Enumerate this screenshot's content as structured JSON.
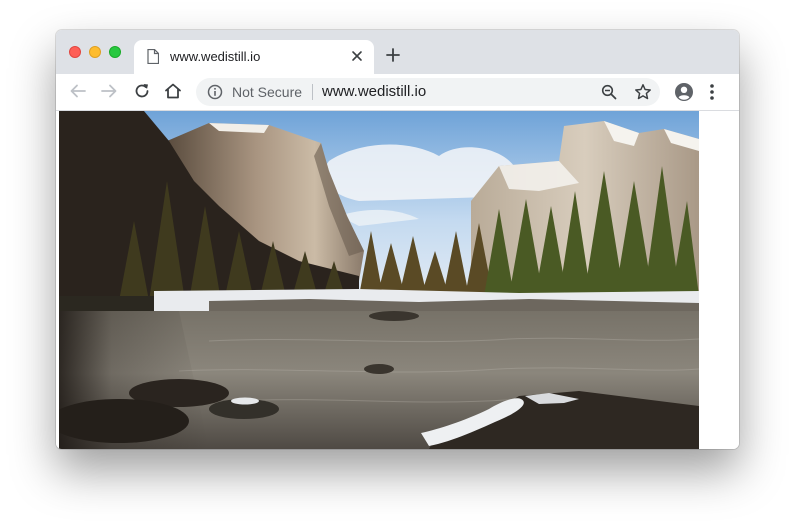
{
  "browser": {
    "tab": {
      "title": "www.wedistill.io"
    },
    "omnibox": {
      "security_label": "Not Secure",
      "url": "www.wedistill.io"
    },
    "icons": {
      "tab": "page-icon",
      "close": "close-icon",
      "new_tab": "plus-icon",
      "back": "back-arrow-icon",
      "forward": "forward-arrow-icon",
      "reload": "reload-icon",
      "home": "home-icon",
      "info": "info-icon",
      "zoom": "zoom-out-icon",
      "bookmark": "star-icon",
      "account": "account-icon",
      "menu": "more-vert-icon"
    },
    "colors": {
      "tabstrip": "#dee1e6",
      "close_light": "#fe5f57",
      "minimize_light": "#febc2e",
      "zoom_light": "#28c840"
    }
  },
  "page": {
    "image": "yosemite-valley-landscape-photo"
  }
}
